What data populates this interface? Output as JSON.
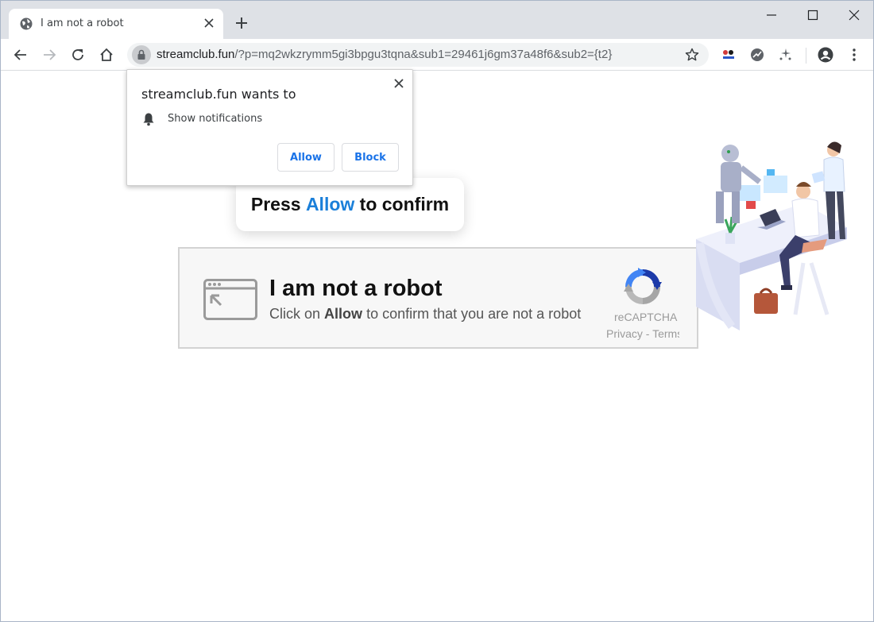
{
  "browser": {
    "tab_title": "I am not a robot",
    "url_host": "streamclub.fun",
    "url_path": "/?p=mq2wkzrymm5gi3bpgu3tqna&sub1=29461j6gm37a48f6&sub2={t2}"
  },
  "permission_prompt": {
    "title": "streamclub.fun wants to",
    "permission": "Show notifications",
    "allow_label": "Allow",
    "block_label": "Block"
  },
  "page": {
    "press_prefix": "Press",
    "press_allow": "Allow",
    "press_suffix": "to confirm",
    "robot_title": "I am not a robot",
    "robot_sub_prefix": "Click on",
    "robot_sub_allow": "Allow",
    "robot_sub_suffix": "to confirm that you are not a robot",
    "recaptcha_label": "reCAPTCHA",
    "recaptcha_links": "Privacy - Terms"
  },
  "colors": {
    "accent_blue": "#1a73e8",
    "allow_highlight": "#1a7fd9",
    "tabstrip_bg": "#dee1e6"
  }
}
